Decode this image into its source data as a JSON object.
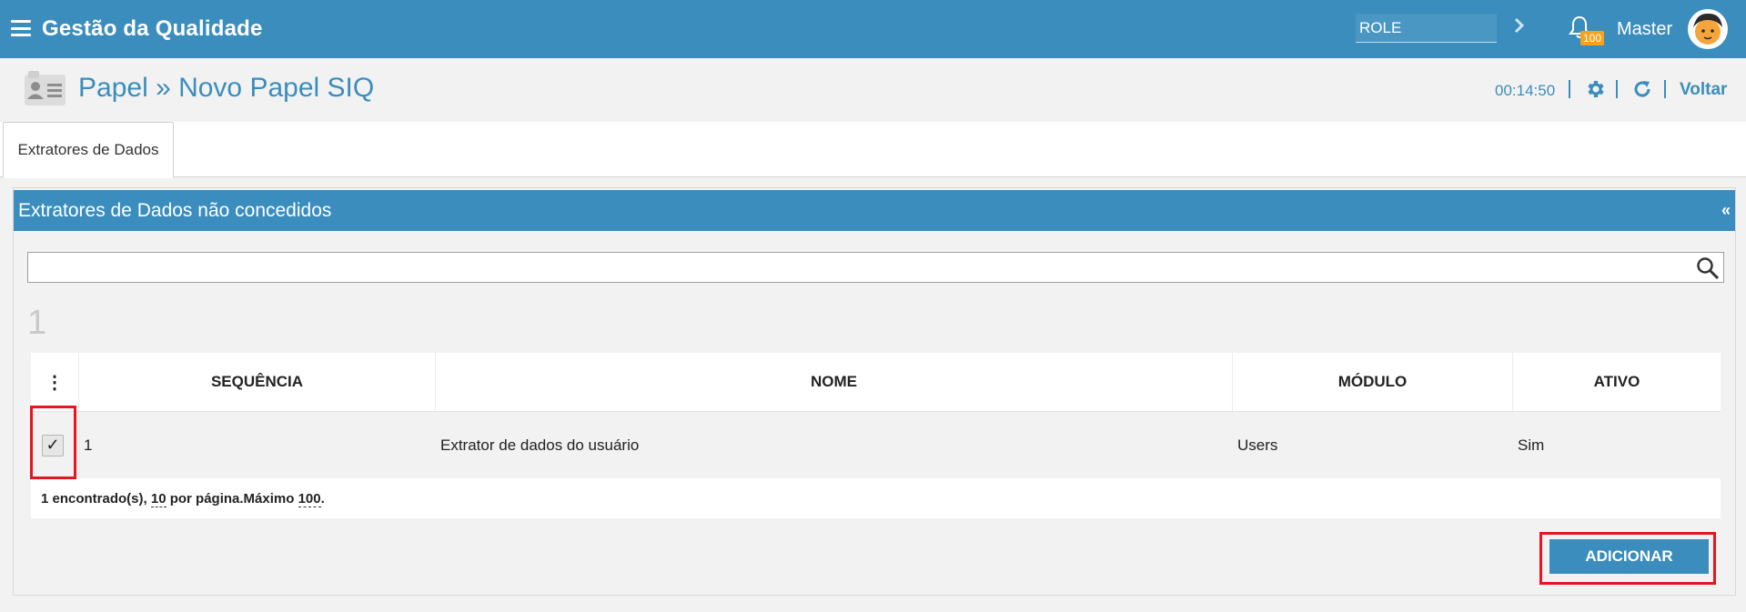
{
  "topbar": {
    "menu_icon": "hamburger-icon",
    "app_title": "Gestão da Qualidade",
    "role_value": "ROLE",
    "role_arrow_icon": "chevron-right-icon",
    "bell_icon": "bell-icon",
    "notifications_count": "100",
    "user_name": "Master",
    "avatar_icon": "user-avatar"
  },
  "page_header": {
    "icon": "id-card-icon",
    "title": "Papel » Novo Papel SIQ",
    "timer": "00:14:50",
    "settings_icon": "gear-icon",
    "refresh_icon": "refresh-icon",
    "back_label": "Voltar"
  },
  "tabs": [
    {
      "label": "Extratores de Dados",
      "active": true
    }
  ],
  "panel": {
    "title": "Extratores de Dados não concedidos",
    "collapse_glyph": "«",
    "search_value": "",
    "search_icon": "search-icon",
    "page_indicator": "1"
  },
  "table": {
    "menu_glyph": "⋮",
    "columns": [
      "SEQUÊNCIA",
      "NOME",
      "MÓDULO",
      "ATIVO"
    ],
    "rows": [
      {
        "checked": true,
        "check_glyph": "✓",
        "sequencia": "1",
        "nome": "Extrator de dados do usuário",
        "modulo": "Users",
        "ativo": "Sim"
      }
    ],
    "footer": {
      "found": "1 encontrado(s), ",
      "per_page_value": "10",
      "per_page_text": " por página.Máximo ",
      "max_value": "100",
      "end": "."
    }
  },
  "actions": {
    "add_label": "ADICIONAR"
  },
  "colors": {
    "primary": "#3b8dbd",
    "badge": "#f7a21b",
    "highlight": "#e8141e"
  }
}
